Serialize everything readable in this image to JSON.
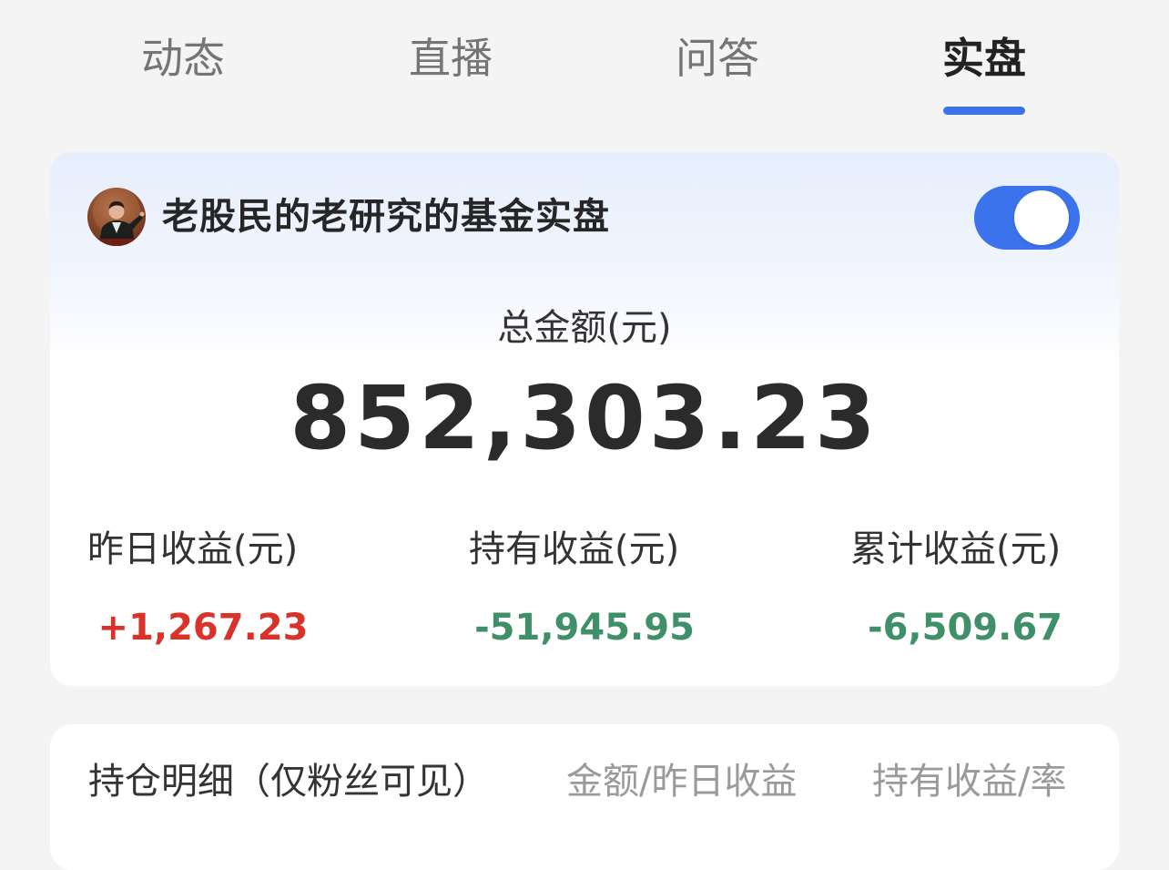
{
  "tabs": [
    {
      "label": "动态",
      "active": false
    },
    {
      "label": "直播",
      "active": false
    },
    {
      "label": "问答",
      "active": false
    },
    {
      "label": "实盘",
      "active": true
    }
  ],
  "account": {
    "name": "老股民的老研究的基金实盘",
    "avatar_icon": "user-avatar",
    "toggle_on": true
  },
  "total": {
    "label": "总金额(元)",
    "value": "852,303.23"
  },
  "stats": [
    {
      "label": "昨日收益(元)",
      "value": "+1,267.23",
      "trend": "up"
    },
    {
      "label": "持有收益(元)",
      "value": "-51,945.95",
      "trend": "down"
    },
    {
      "label": "累计收益(元)",
      "value": "-6,509.67",
      "trend": "down"
    }
  ],
  "holdings": {
    "title": "持仓明细（仅粉丝可见）",
    "col_amount": "金额/昨日收益",
    "col_hold": "持有收益/率"
  },
  "colors": {
    "accent": "#3a72ea",
    "gain": "#d9322b",
    "loss": "#3f8f68"
  }
}
